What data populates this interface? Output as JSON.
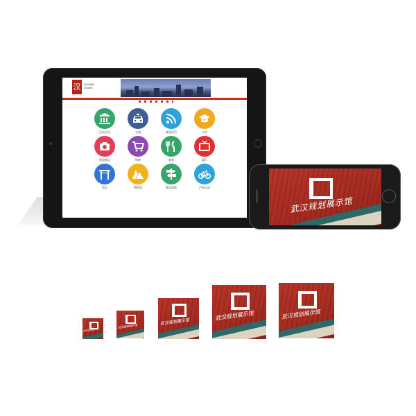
{
  "tablet": {
    "logo_char": "汉",
    "brand_lines": [
      "WUHAN",
      "GUIDE"
    ],
    "apps": [
      {
        "label": "历史文化",
        "color": "#35a56b",
        "icon": "bank-icon"
      },
      {
        "label": "交通",
        "color": "#3f5e92",
        "icon": "taxi-icon"
      },
      {
        "label": "旅游资讯",
        "color": "#2fa2db",
        "icon": "wifi-icon"
      },
      {
        "label": "大学",
        "color": "#f0a821",
        "icon": "graduation-cap-icon"
      },
      {
        "label": "旅游景点",
        "color": "#e23f57",
        "icon": "camera-icon"
      },
      {
        "label": "购物",
        "color": "#8e49b3",
        "icon": "cart-icon"
      },
      {
        "label": "美食",
        "color": "#35a56b",
        "icon": "fork-knife-icon"
      },
      {
        "label": "娱乐",
        "color": "#df2f2f",
        "icon": "tv-icon"
      },
      {
        "label": "酒店",
        "color": "#3176d6",
        "icon": "gate-icon"
      },
      {
        "label": "博物馆",
        "color": "#f3b21b",
        "icon": "mountain-icon"
      },
      {
        "label": "精品路线",
        "color": "#35a56b",
        "icon": "signpost-icon"
      },
      {
        "label": "户外运动",
        "color": "#2fa2db",
        "icon": "bicycle-icon"
      }
    ]
  },
  "artwork": {
    "title": "武汉规划展示馆",
    "mark": "Ͻ"
  },
  "colors": {
    "accent_red": "#c7301d",
    "facade_red": "#b83428",
    "glass_teal": "#2c6a6a"
  }
}
